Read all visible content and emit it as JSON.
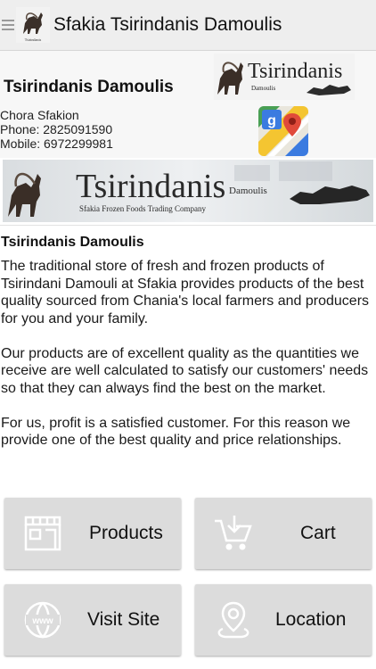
{
  "appbar": {
    "title": "Sfakia Tsirindanis Damoulis",
    "logo_caption": "Tsirindanis"
  },
  "info": {
    "name": "Tsirindanis Damoulis",
    "logo_word": "Tsirindanis",
    "logo_sub": "Damoulis",
    "location": "Chora Sfakion",
    "phone": "Phone: 2825091590",
    "mobile": "Mobile: 6972299981",
    "maps_icon": "google-maps-icon"
  },
  "banner": {
    "word": "Tsirindanis",
    "sub": "Damoulis",
    "tagline": "Sfakia Frozen Foods Trading Company"
  },
  "description": {
    "heading": "Tsirindanis Damoulis",
    "paragraphs": [
      "The traditional store of fresh and frozen products of Tsirindani Damouli at Sfakia provides products of the best quality sourced from Chania's local  farmers and producers for you and your family.",
      "Our products are of excellent quality as the quantities we receive are well calculated to satisfy our customers' needs so that they can always find the best on the market.",
      "For us, profit is a satisfied customer. For this reason we provide one of the best quality and price relationships."
    ]
  },
  "buttons": [
    {
      "label": "Products",
      "icon": "store-icon"
    },
    {
      "label": "Cart",
      "icon": "cart-icon"
    },
    {
      "label": "Visit Site",
      "icon": "globe-www-icon"
    },
    {
      "label": "Location",
      "icon": "location-pin-icon"
    }
  ],
  "colors": {
    "appbar_bg": "#eeeeee",
    "button_bg": "#dcdcdc",
    "icon_white": "#ffffff"
  }
}
